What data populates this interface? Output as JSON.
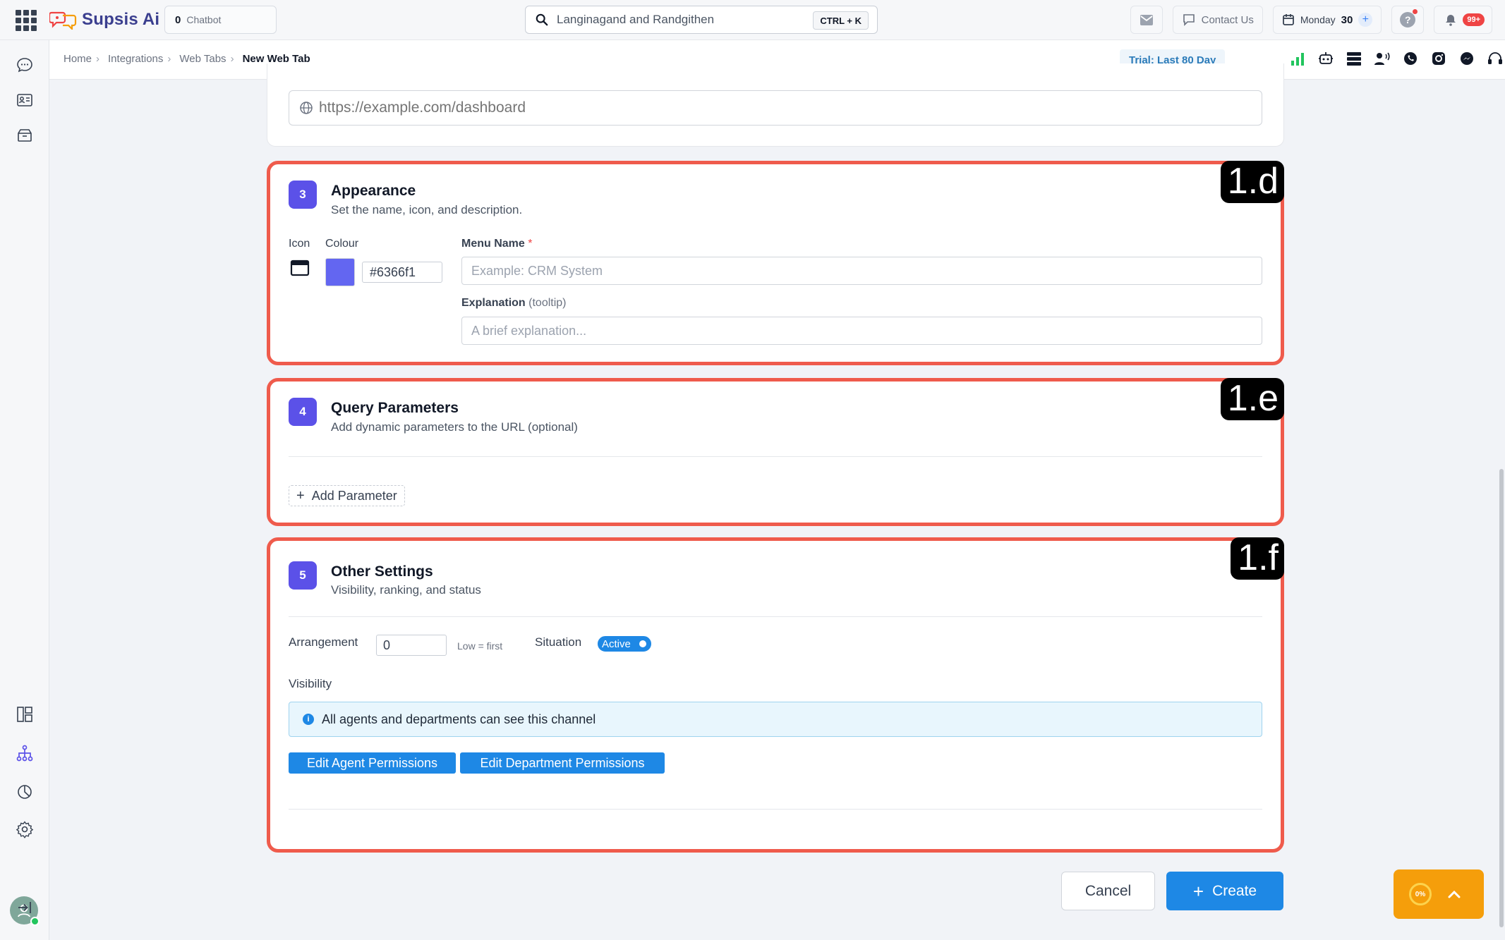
{
  "app": {
    "brand": "Supsis Ai",
    "chatbot": {
      "count": "0",
      "label": "Chatbot"
    },
    "search": {
      "value": "Langinagand and Randgithen",
      "shortcut": "CTRL + K"
    },
    "contact_label": "Contact Us",
    "date": {
      "day": "Monday",
      "num": "30"
    },
    "notification_badge": "99+"
  },
  "breadcrumb": {
    "items": [
      "Home",
      "Integrations",
      "Web Tabs"
    ],
    "current": "New Web Tab",
    "separator": "›"
  },
  "trial_label": "Trial: Last 80 Day",
  "url_section": {
    "placeholder": "https://example.com/dashboard"
  },
  "appearance": {
    "step": "3",
    "title": "Appearance",
    "subtitle": "Set the name, icon, and description.",
    "icon_label": "Icon",
    "colour_label": "Colour",
    "colour_value": "#6366f1",
    "menu_name_label": "Menu Name",
    "required_mark": "*",
    "menu_name_placeholder": "Example: CRM System",
    "explanation_label": "Explanation",
    "explanation_hint": "(tooltip)",
    "explanation_placeholder": "A brief explanation...",
    "annotation": "1.d"
  },
  "query_params": {
    "step": "4",
    "title": "Query Parameters",
    "subtitle": "Add dynamic parameters to the URL (optional)",
    "add_label": "Add Parameter",
    "annotation": "1.e"
  },
  "other_settings": {
    "step": "5",
    "title": "Other Settings",
    "subtitle": "Visibility, ranking, and status",
    "arrangement_label": "Arrangement",
    "arrangement_value": "0",
    "arrangement_hint": "Low = first",
    "situation_label": "Situation",
    "situation_value": "Active",
    "visibility_label": "Visibility",
    "visibility_info": "All agents and departments can see this channel",
    "edit_agent_label": "Edit Agent Permissions",
    "edit_department_label": "Edit Department Permissions",
    "annotation": "1.f"
  },
  "footer": {
    "cancel_label": "Cancel",
    "create_label": "Create",
    "progress_text": "0%"
  },
  "colors": {
    "accent": "#1e88e5",
    "step_badge": "#5b51e8",
    "highlight_border": "#ef5b4c",
    "swatch": "#6366f1",
    "progress_widget": "#f59e0b"
  }
}
